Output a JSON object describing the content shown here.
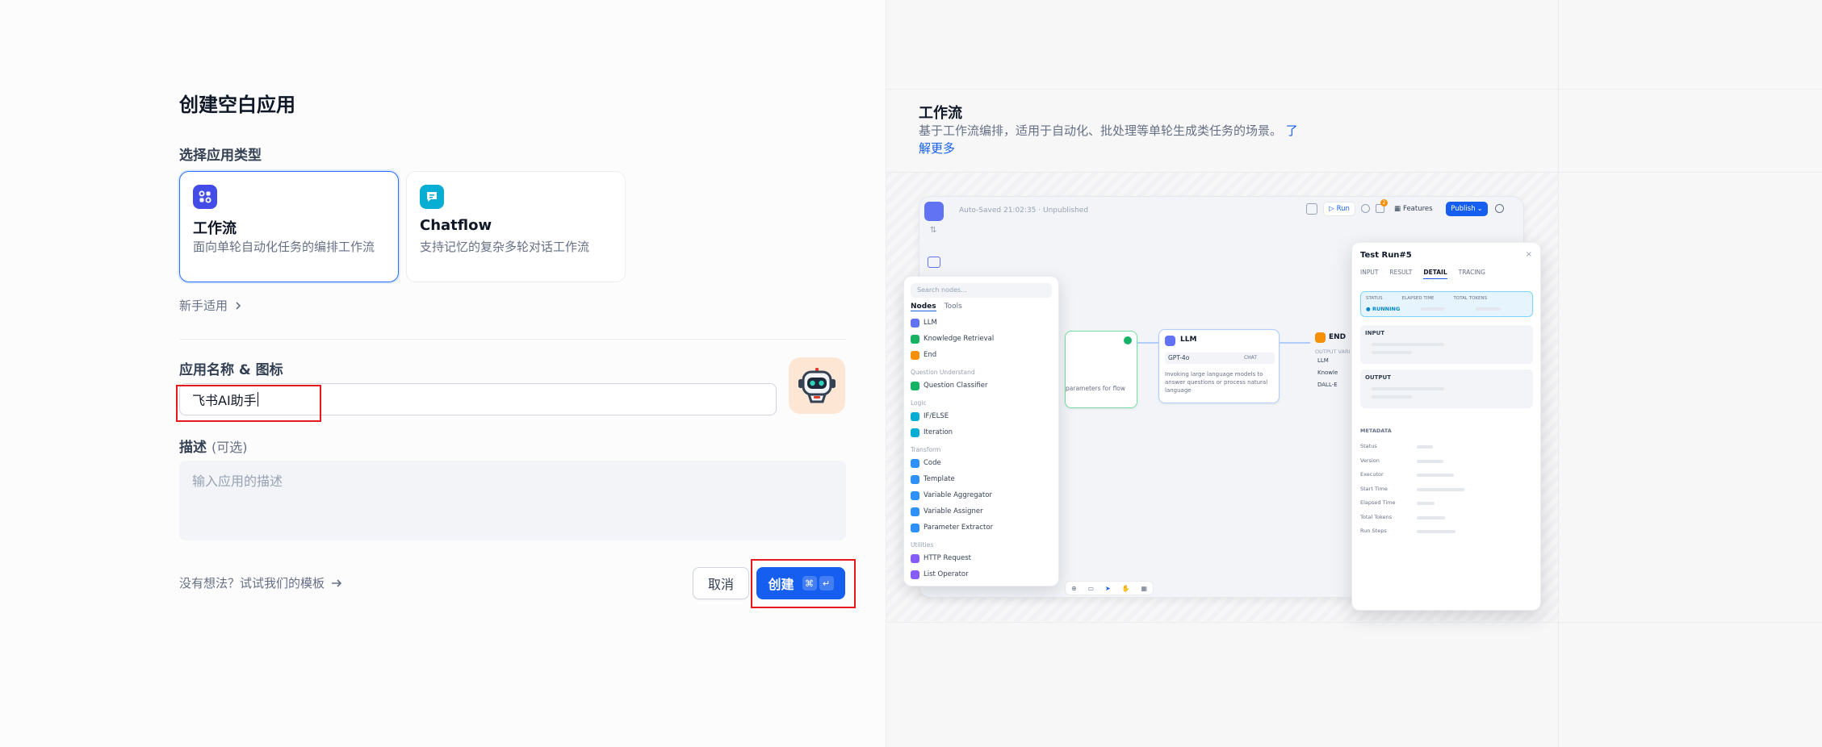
{
  "page_title": "创建空白应用",
  "app_type": {
    "label": "选择应用类型",
    "options": [
      {
        "name": "工作流",
        "desc": "面向单轮自动化任务的编排工作流",
        "selected": true,
        "icon": "workflow-icon",
        "color": "#444ce7"
      },
      {
        "name": "Chatflow",
        "desc": "支持记忆的复杂多轮对话工作流",
        "selected": false,
        "icon": "chatflow-icon",
        "color": "#06aed4"
      }
    ]
  },
  "beginner_link": "新手适用",
  "name_field": {
    "label": "应用名称 & 图标",
    "value": "飞书AI助手",
    "avatar_icon": "robot-icon"
  },
  "description_field": {
    "label": "描述",
    "optional": "(可选)",
    "placeholder": "输入应用的描述"
  },
  "template_link": "没有想法？试试我们的模板",
  "buttons": {
    "cancel": "取消",
    "create": "创建",
    "shortcut_cmd": "⌘",
    "shortcut_enter": "↵"
  },
  "info_panel": {
    "title": "工作流",
    "description": "基于工作流编排，适用于自动化、批处理等单轮生成类任务的场景。",
    "learn_more": "了解更多"
  },
  "preview": {
    "autosave": "Auto-Saved 21:02:35 · Unpublished",
    "toolbar": {
      "run": "Run",
      "features": "Features",
      "publish": "Publish",
      "badge": "2"
    },
    "nodes_panel": {
      "search_placeholder": "Search nodes...",
      "tabs": [
        "Nodes",
        "Tools"
      ],
      "groups": [
        {
          "title": "",
          "items": [
            {
              "label": "LLM",
              "color": "#6172f3"
            },
            {
              "label": "Knowledge Retrieval",
              "color": "#16b364"
            },
            {
              "label": "End",
              "color": "#f79009"
            }
          ]
        },
        {
          "title": "Question Understand",
          "items": [
            {
              "label": "Question Classifier",
              "color": "#16b364"
            }
          ]
        },
        {
          "title": "Logic",
          "items": [
            {
              "label": "IF/ELSE",
              "color": "#06aed4"
            },
            {
              "label": "Iteration",
              "color": "#06aed4"
            }
          ]
        },
        {
          "title": "Transform",
          "items": [
            {
              "label": "Code",
              "color": "#2e90fa"
            },
            {
              "label": "Template",
              "color": "#2e90fa"
            },
            {
              "label": "Variable Aggregator",
              "color": "#2e90fa"
            },
            {
              "label": "Variable Assigner",
              "color": "#2e90fa"
            },
            {
              "label": "Parameter Extractor",
              "color": "#2e90fa"
            }
          ]
        },
        {
          "title": "Utilities",
          "items": [
            {
              "label": "HTTP Request",
              "color": "#875bf7"
            },
            {
              "label": "List Operator",
              "color": "#875bf7"
            }
          ]
        }
      ]
    },
    "llm_node": {
      "title": "LLM",
      "model": "GPT-4o",
      "mode": "CHAT",
      "desc": "Invoking large language models to answer questions or process natural language"
    },
    "left_node_desc": "parameters for flow",
    "end_node": {
      "title": "END",
      "output_label": "OUTPUT VARI",
      "items": [
        "LLM",
        "Knowle",
        "DALL-E"
      ]
    },
    "run_panel": {
      "title": "Test Run#5",
      "tabs": [
        "INPUT",
        "RESULT",
        "DETAIL",
        "TRACING"
      ],
      "active_tab": "DETAIL",
      "status_headers": [
        "STATUS",
        "ELAPSED TIME",
        "TOTAL TOKENS"
      ],
      "status_value": "RUNNING",
      "input_label": "INPUT",
      "output_label": "OUTPUT",
      "metadata_label": "METADATA",
      "metadata_keys": [
        "Status",
        "Version",
        "Executor",
        "Start Time",
        "Elapsed Time",
        "Total Tokens",
        "Run Steps"
      ]
    }
  }
}
